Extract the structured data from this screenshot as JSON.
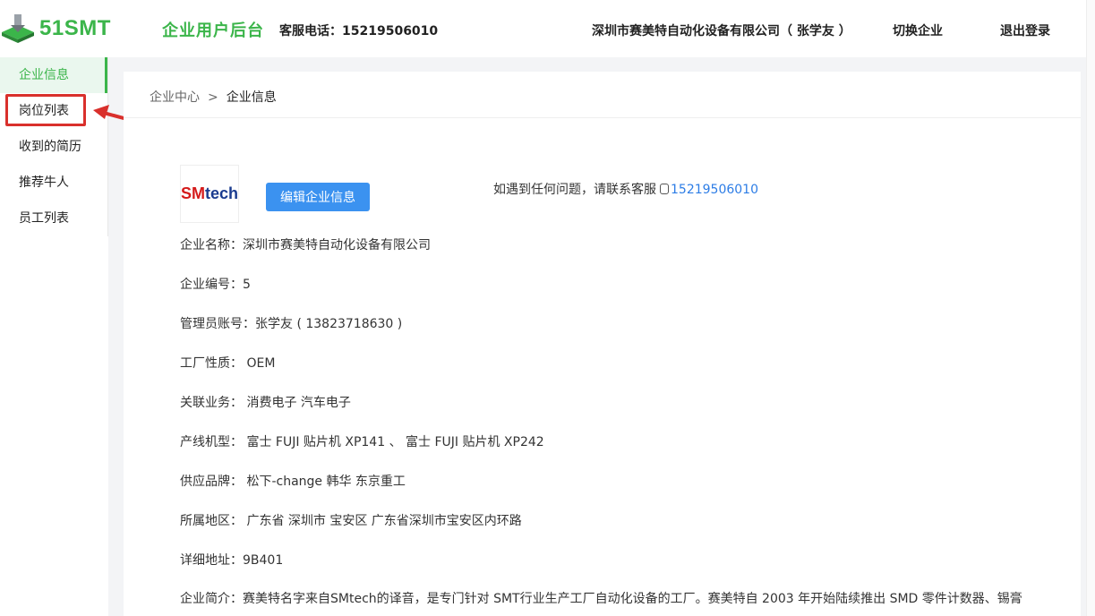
{
  "header": {
    "logo_text": "51SMT",
    "portal_title": "企业用户后台",
    "hotline_label": "客服电话：",
    "hotline_number": "15219506010",
    "company_user": "深圳市赛美特自动化设备有限公司（ 张学友 ）",
    "switch_label": "切换企业",
    "logout_label": "退出登录"
  },
  "sidebar": {
    "items": [
      {
        "label": "企业信息"
      },
      {
        "label": "岗位列表"
      },
      {
        "label": "收到的简历"
      },
      {
        "label": "推荐牛人"
      },
      {
        "label": "员工列表"
      }
    ]
  },
  "breadcrumb": {
    "parent": "企业中心",
    "separator": ">",
    "current": "企业信息"
  },
  "company_logo": {
    "sm": "SM",
    "tech": "tech"
  },
  "edit_button": "编辑企业信息",
  "help": {
    "text": "如遇到任何问题，请联系客服",
    "phone": "15219506010"
  },
  "info": {
    "name_label": "企业名称：",
    "name_value": "深圳市赛美特自动化设备有限公司",
    "id_label": "企业编号：",
    "id_value": "5",
    "admin_label": "管理员账号：",
    "admin_value": "张学友 ( 13823718630 )",
    "nature_label": "工厂性质：",
    "nature_value": "OEM",
    "business_label": "关联业务：",
    "business_value": "消费电子 汽车电子",
    "machines_label": "产线机型：",
    "machines_value": "富士 FUJI 贴片机 XP141 、 富士 FUJI 贴片机 XP242",
    "brands_label": "供应品牌：",
    "brands_value": "松下-change 韩华 东京重工",
    "region_label": "所属地区：",
    "region_value": "广东省 深圳市 宝安区 广东省深圳市宝安区内环路",
    "address_label": "详细地址：",
    "address_value": "9B401",
    "intro_label": "企业简介：",
    "intro_value": "赛美特名字来自SMtech的译音，是专门针对 SMT行业生产工厂自动化设备的工厂。赛美特自 2003 年开始陆续推出 SMD 零件计数器、锡膏"
  },
  "colors": {
    "brand_green": "#3bb54a",
    "button_blue": "#3b92f0",
    "link_blue": "#2d7de6",
    "highlight_red": "#d9302c"
  }
}
